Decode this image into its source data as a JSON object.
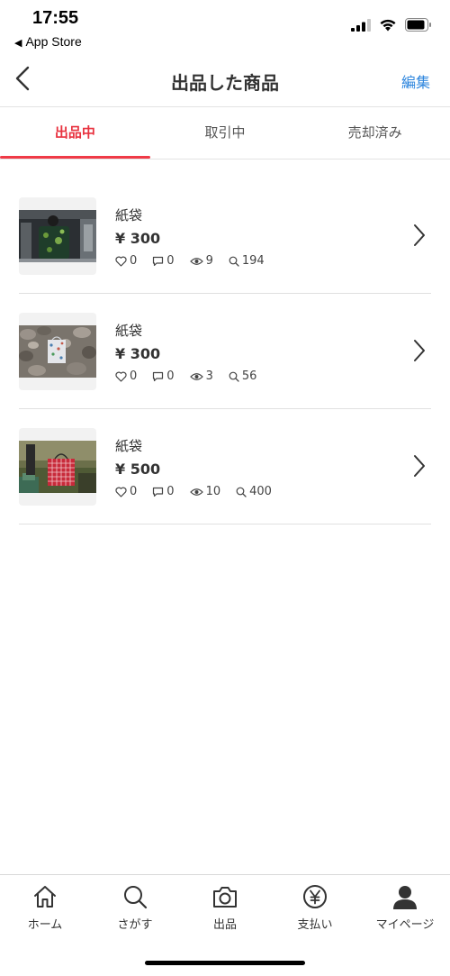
{
  "status_bar": {
    "time": "17:55",
    "back_app": "App Store",
    "icons": [
      "cellular-signal-icon",
      "wifi-icon",
      "battery-icon"
    ]
  },
  "nav": {
    "title": "出品した商品",
    "edit_label": "編集",
    "back_icon": "chevron-left-icon"
  },
  "tabs": [
    {
      "label": "出品中",
      "active": true
    },
    {
      "label": "取引中",
      "active": false
    },
    {
      "label": "売却済み",
      "active": false
    }
  ],
  "items": [
    {
      "name": "紙袋",
      "price": "¥ 300",
      "likes": "0",
      "comments": "0",
      "views": "9",
      "searches": "194"
    },
    {
      "name": "紙袋",
      "price": "¥ 300",
      "likes": "0",
      "comments": "0",
      "views": "3",
      "searches": "56"
    },
    {
      "name": "紙袋",
      "price": "¥ 500",
      "likes": "0",
      "comments": "0",
      "views": "10",
      "searches": "400"
    }
  ],
  "tab_bar": [
    {
      "label": "ホーム",
      "icon": "home-icon"
    },
    {
      "label": "さがす",
      "icon": "search-icon"
    },
    {
      "label": "出品",
      "icon": "camera-icon"
    },
    {
      "label": "支払い",
      "icon": "yen-icon"
    },
    {
      "label": "マイページ",
      "icon": "person-icon"
    }
  ],
  "colors": {
    "accent_red": "#e8323f",
    "link_blue": "#2e86de"
  }
}
